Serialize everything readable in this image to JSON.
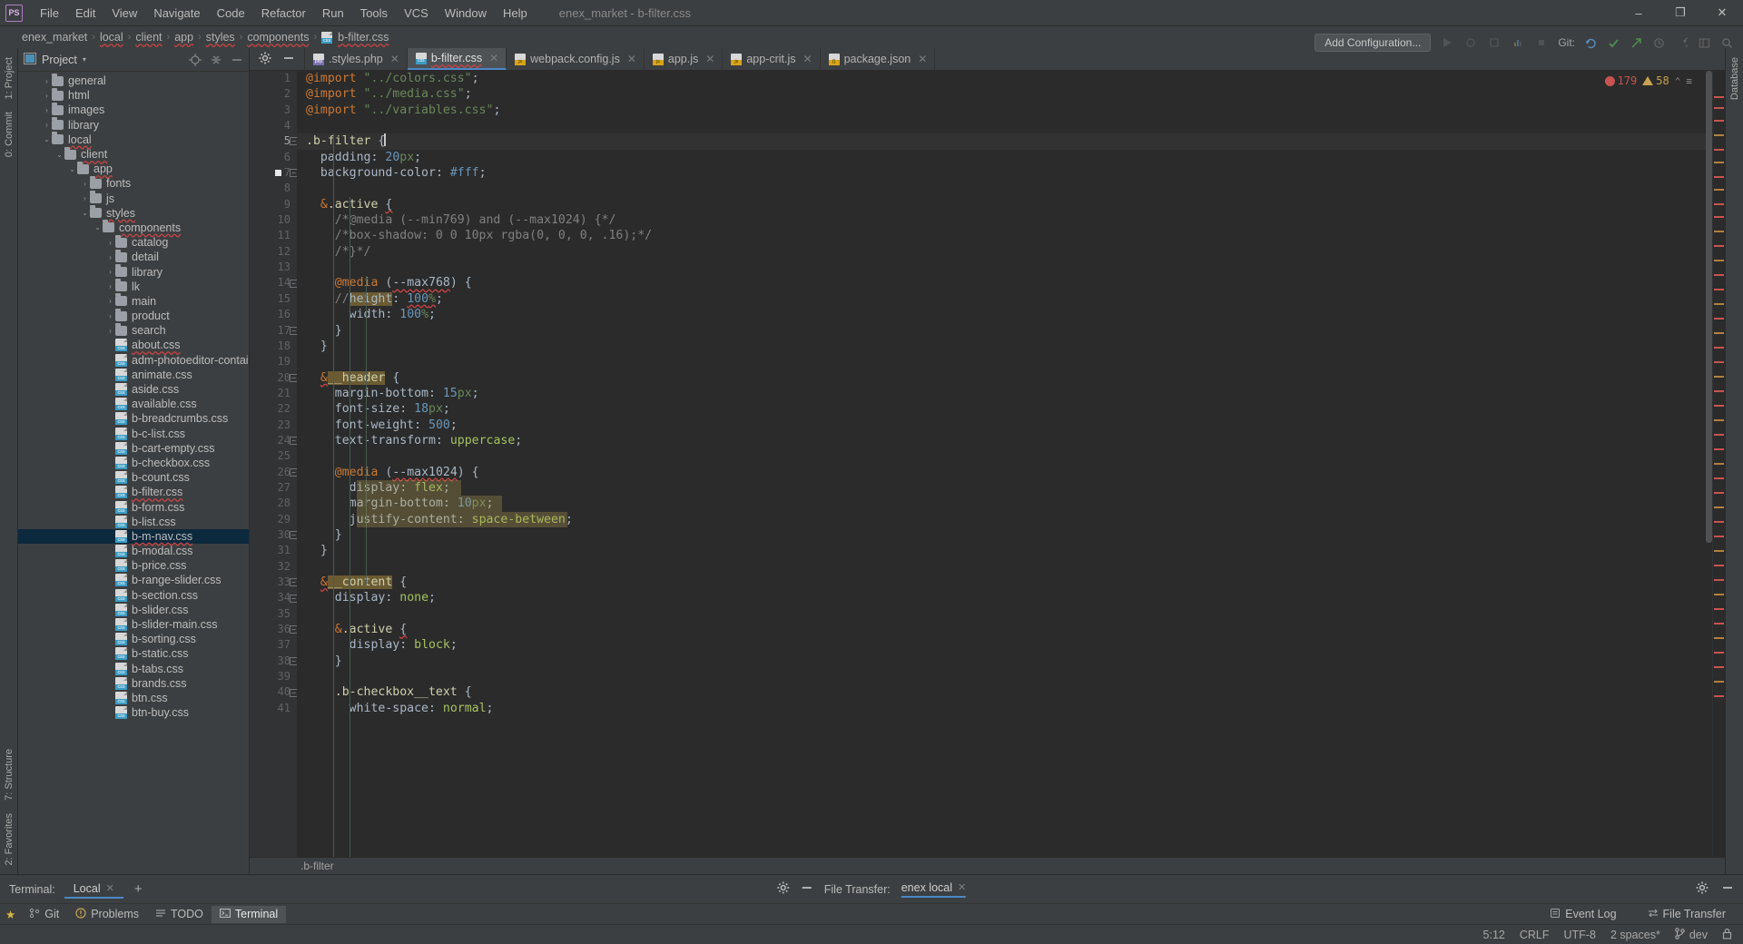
{
  "window": {
    "title": "enex_market - b-filter.css",
    "logo": "PS",
    "minimize": "–",
    "maximize": "❐",
    "close": "✕"
  },
  "menubar": {
    "items": [
      "File",
      "Edit",
      "View",
      "Navigate",
      "Code",
      "Refactor",
      "Run",
      "Tools",
      "VCS",
      "Window",
      "Help"
    ]
  },
  "breadcrumb": {
    "items": [
      "enex_market",
      "local",
      "client",
      "app",
      "styles",
      "components"
    ],
    "file": "b-filter.css",
    "file_icon": "css-file-icon",
    "separator": "›"
  },
  "toolbar": {
    "add_configuration": "Add Configuration...",
    "git_label": "Git:",
    "icons": [
      "run-icon",
      "debug-icon",
      "coverage-icon",
      "profiler-icon",
      "stop-icon",
      "search-everywhere-icon",
      "settings-icon"
    ],
    "git_icons": [
      "update-project-icon",
      "commit-checkmark-icon",
      "push-arrow-icon",
      "history-icon",
      "undo-icon",
      "layout-icon",
      "settings-icon"
    ]
  },
  "left_rail": {
    "top": [
      "1: Project"
    ],
    "bottom": [
      "0: Commit"
    ]
  },
  "right_rail": {
    "top": [
      "Database"
    ]
  },
  "left_rail_bottom": {
    "items": [
      "7: Structure",
      "2: Favorites"
    ]
  },
  "project_panel": {
    "title": "Project",
    "caret": "▾",
    "icons": [
      "locate-icon",
      "collapse-all-icon",
      "hide-icon"
    ],
    "tree": [
      {
        "depth": 1,
        "arrow": "›",
        "type": "folder",
        "name": "general",
        "spell": false,
        "selected": false
      },
      {
        "depth": 1,
        "arrow": "›",
        "type": "folder",
        "name": "html",
        "spell": false,
        "selected": false
      },
      {
        "depth": 1,
        "arrow": "›",
        "type": "folder",
        "name": "images",
        "spell": false,
        "selected": false
      },
      {
        "depth": 1,
        "arrow": "›",
        "type": "folder",
        "name": "library",
        "spell": false,
        "selected": false
      },
      {
        "depth": 1,
        "arrow": "⌄",
        "type": "folder",
        "name": "local",
        "spell": true,
        "selected": false
      },
      {
        "depth": 2,
        "arrow": "⌄",
        "type": "folder",
        "name": "client",
        "spell": true,
        "selected": false
      },
      {
        "depth": 3,
        "arrow": "⌄",
        "type": "folder",
        "name": "app",
        "spell": true,
        "selected": false
      },
      {
        "depth": 4,
        "arrow": "›",
        "type": "folder",
        "name": "fonts",
        "spell": false,
        "selected": false
      },
      {
        "depth": 4,
        "arrow": "›",
        "type": "folder",
        "name": "js",
        "spell": false,
        "selected": false
      },
      {
        "depth": 4,
        "arrow": "⌄",
        "type": "folder",
        "name": "styles",
        "spell": true,
        "selected": false
      },
      {
        "depth": 5,
        "arrow": "⌄",
        "type": "folder",
        "name": "components",
        "spell": true,
        "selected": false
      },
      {
        "depth": 6,
        "arrow": "›",
        "type": "folder",
        "name": "catalog",
        "spell": false,
        "selected": false
      },
      {
        "depth": 6,
        "arrow": "›",
        "type": "folder",
        "name": "detail",
        "spell": false,
        "selected": false
      },
      {
        "depth": 6,
        "arrow": "›",
        "type": "folder",
        "name": "library",
        "spell": false,
        "selected": false
      },
      {
        "depth": 6,
        "arrow": "›",
        "type": "folder",
        "name": "lk",
        "spell": false,
        "selected": false
      },
      {
        "depth": 6,
        "arrow": "›",
        "type": "folder",
        "name": "main",
        "spell": false,
        "selected": false
      },
      {
        "depth": 6,
        "arrow": "›",
        "type": "folder",
        "name": "product",
        "spell": false,
        "selected": false
      },
      {
        "depth": 6,
        "arrow": "›",
        "type": "folder",
        "name": "search",
        "spell": false,
        "selected": false
      },
      {
        "depth": 6,
        "arrow": "",
        "type": "css",
        "name": "about.css",
        "spell": true,
        "selected": false
      },
      {
        "depth": 6,
        "arrow": "",
        "type": "css",
        "name": "adm-photoeditor-container.css",
        "spell": false,
        "selected": false
      },
      {
        "depth": 6,
        "arrow": "",
        "type": "css",
        "name": "animate.css",
        "spell": false,
        "selected": false
      },
      {
        "depth": 6,
        "arrow": "",
        "type": "css",
        "name": "aside.css",
        "spell": false,
        "selected": false
      },
      {
        "depth": 6,
        "arrow": "",
        "type": "css",
        "name": "available.css",
        "spell": false,
        "selected": false
      },
      {
        "depth": 6,
        "arrow": "",
        "type": "css",
        "name": "b-breadcrumbs.css",
        "spell": false,
        "selected": false
      },
      {
        "depth": 6,
        "arrow": "",
        "type": "css",
        "name": "b-c-list.css",
        "spell": false,
        "selected": false
      },
      {
        "depth": 6,
        "arrow": "",
        "type": "css",
        "name": "b-cart-empty.css",
        "spell": false,
        "selected": false
      },
      {
        "depth": 6,
        "arrow": "",
        "type": "css",
        "name": "b-checkbox.css",
        "spell": false,
        "selected": false
      },
      {
        "depth": 6,
        "arrow": "",
        "type": "css",
        "name": "b-count.css",
        "spell": false,
        "selected": false
      },
      {
        "depth": 6,
        "arrow": "",
        "type": "css",
        "name": "b-filter.css",
        "spell": true,
        "selected": false
      },
      {
        "depth": 6,
        "arrow": "",
        "type": "css",
        "name": "b-form.css",
        "spell": false,
        "selected": false
      },
      {
        "depth": 6,
        "arrow": "",
        "type": "css",
        "name": "b-list.css",
        "spell": false,
        "selected": false
      },
      {
        "depth": 6,
        "arrow": "",
        "type": "css",
        "name": "b-m-nav.css",
        "spell": true,
        "selected": true
      },
      {
        "depth": 6,
        "arrow": "",
        "type": "css",
        "name": "b-modal.css",
        "spell": false,
        "selected": false
      },
      {
        "depth": 6,
        "arrow": "",
        "type": "css",
        "name": "b-price.css",
        "spell": false,
        "selected": false
      },
      {
        "depth": 6,
        "arrow": "",
        "type": "css",
        "name": "b-range-slider.css",
        "spell": false,
        "selected": false
      },
      {
        "depth": 6,
        "arrow": "",
        "type": "css",
        "name": "b-section.css",
        "spell": false,
        "selected": false
      },
      {
        "depth": 6,
        "arrow": "",
        "type": "css",
        "name": "b-slider.css",
        "spell": false,
        "selected": false
      },
      {
        "depth": 6,
        "arrow": "",
        "type": "css",
        "name": "b-slider-main.css",
        "spell": false,
        "selected": false
      },
      {
        "depth": 6,
        "arrow": "",
        "type": "css",
        "name": "b-sorting.css",
        "spell": false,
        "selected": false
      },
      {
        "depth": 6,
        "arrow": "",
        "type": "css",
        "name": "b-static.css",
        "spell": false,
        "selected": false
      },
      {
        "depth": 6,
        "arrow": "",
        "type": "css",
        "name": "b-tabs.css",
        "spell": false,
        "selected": false
      },
      {
        "depth": 6,
        "arrow": "",
        "type": "css",
        "name": "brands.css",
        "spell": false,
        "selected": false
      },
      {
        "depth": 6,
        "arrow": "",
        "type": "css",
        "name": "btn.css",
        "spell": false,
        "selected": false
      },
      {
        "depth": 6,
        "arrow": "",
        "type": "css",
        "name": "btn-buy.css",
        "spell": false,
        "selected": false
      }
    ]
  },
  "editor_tabs": [
    {
      "label": ".styles.php",
      "icon": "php",
      "active": false,
      "close": "✕",
      "spell": false
    },
    {
      "label": "b-filter.css",
      "icon": "css",
      "active": true,
      "close": "✕",
      "spell": true
    },
    {
      "label": "webpack.config.js",
      "icon": "js",
      "active": false,
      "close": "✕",
      "spell": false
    },
    {
      "label": "app.js",
      "icon": "js",
      "active": false,
      "close": "✕",
      "spell": false
    },
    {
      "label": "app-crit.js",
      "icon": "js",
      "active": false,
      "close": "✕",
      "spell": false
    },
    {
      "label": "package.json",
      "icon": "json",
      "active": false,
      "close": "✕",
      "spell": false
    }
  ],
  "inspections": {
    "error_count": "179",
    "warning_count": "58",
    "chevron_up": "⌃",
    "menu": "≡"
  },
  "editor": {
    "first_line": 1,
    "current_line": 5,
    "breadcrumb": ".b-filter",
    "lines": [
      {
        "n": 1,
        "text": "@import \"../colors.css\";"
      },
      {
        "n": 2,
        "text": "@import \"../media.css\";"
      },
      {
        "n": 3,
        "text": "@import \"../variables.css\";"
      },
      {
        "n": 4,
        "text": ""
      },
      {
        "n": 5,
        "text": ".b-filter {"
      },
      {
        "n": 6,
        "text": "  padding: 20px;"
      },
      {
        "n": 7,
        "text": "  background-color: #fff;"
      },
      {
        "n": 8,
        "text": ""
      },
      {
        "n": 9,
        "text": "  &.active {"
      },
      {
        "n": 10,
        "text": "    /*@media (--min769) and (--max1024) {*/"
      },
      {
        "n": 11,
        "text": "    /*box-shadow: 0 0 10px rgba(0, 0, 0, .16);*/"
      },
      {
        "n": 12,
        "text": "    /*}*/"
      },
      {
        "n": 13,
        "text": ""
      },
      {
        "n": 14,
        "text": "    @media (--max768) {"
      },
      {
        "n": 15,
        "text": "    //height: 100%;"
      },
      {
        "n": 16,
        "text": "      width: 100%;"
      },
      {
        "n": 17,
        "text": "    }"
      },
      {
        "n": 18,
        "text": "  }"
      },
      {
        "n": 19,
        "text": ""
      },
      {
        "n": 20,
        "text": "  &__header {"
      },
      {
        "n": 21,
        "text": "    margin-bottom: 15px;"
      },
      {
        "n": 22,
        "text": "    font-size: 18px;"
      },
      {
        "n": 23,
        "text": "    font-weight: 500;"
      },
      {
        "n": 24,
        "text": "    text-transform: uppercase;"
      },
      {
        "n": 25,
        "text": ""
      },
      {
        "n": 26,
        "text": "    @media (--max1024) {"
      },
      {
        "n": 27,
        "text": "      display: flex;"
      },
      {
        "n": 28,
        "text": "      margin-bottom: 10px;"
      },
      {
        "n": 29,
        "text": "      justify-content: space-between;"
      },
      {
        "n": 30,
        "text": "    }"
      },
      {
        "n": 31,
        "text": "  }"
      },
      {
        "n": 32,
        "text": ""
      },
      {
        "n": 33,
        "text": "  &__content {"
      },
      {
        "n": 34,
        "text": "    display: none;"
      },
      {
        "n": 35,
        "text": ""
      },
      {
        "n": 36,
        "text": "    &.active {"
      },
      {
        "n": 37,
        "text": "      display: block;"
      },
      {
        "n": 38,
        "text": "    }"
      },
      {
        "n": 39,
        "text": ""
      },
      {
        "n": 40,
        "text": "    .b-checkbox__text {"
      },
      {
        "n": 41,
        "text": "      white-space: normal;"
      }
    ]
  },
  "bottom_panel": {
    "terminal_label": "Terminal:",
    "terminal_tab": "Local",
    "terminal_close": "✕",
    "add": "+",
    "file_transfer_label": "File Transfer:",
    "file_transfer_tab": "enex local",
    "file_transfer_close": "✕",
    "settings_icon": "gear-icon",
    "minimize_icon": "minimize-icon"
  },
  "tool_buttons": {
    "left": [
      {
        "label": "Git",
        "icon": "git-icon"
      },
      {
        "label": "Problems",
        "icon": "problems-icon"
      },
      {
        "label": "TODO",
        "icon": "todo-icon"
      },
      {
        "label": "Terminal",
        "icon": "terminal-icon",
        "active": true
      }
    ],
    "right": [
      {
        "label": "Event Log",
        "icon": "event-log-icon"
      },
      {
        "label": "File Transfer",
        "icon": "file-transfer-icon"
      }
    ]
  },
  "status_bar": {
    "caret_position": "5:12",
    "line_separator": "CRLF",
    "encoding": "UTF-8",
    "indent": "2 spaces*",
    "branch": "dev",
    "branch_icon": "git-branch-icon",
    "lock_icon": "lock-icon"
  },
  "colors": {
    "accent": "#4a88c7",
    "bg_panel": "#3c3f41",
    "bg_editor": "#2b2b2b",
    "gutter": "#313335",
    "selection": "#0d293e",
    "error": "#c75450",
    "warning": "#c7a252"
  }
}
